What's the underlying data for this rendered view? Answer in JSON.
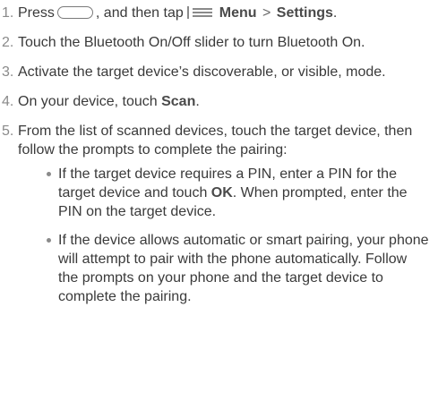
{
  "steps": [
    {
      "number": "1.",
      "parts": {
        "press": "Press",
        "then_tap": ", and then tap",
        "menu": "Menu",
        "separator": ">",
        "settings": "Settings",
        "period": "."
      },
      "icons": [
        "home-key-icon",
        "menu-key-icon"
      ]
    },
    {
      "number": "2.",
      "text": "Touch the Bluetooth On/Off slider to turn Bluetooth On."
    },
    {
      "number": "3.",
      "text": "Activate the target device’s discoverable, or visible, mode."
    },
    {
      "number": "4.",
      "parts": {
        "lead": "On your device, touch ",
        "scan": "Scan",
        "period": "."
      }
    },
    {
      "number": "5.",
      "text": "From the list of scanned devices, touch the target device, then follow the prompts to complete the pairing:",
      "bullets": [
        {
          "lead": "If the target device requires a PIN, enter a PIN for the target device and touch ",
          "ok": "OK",
          "tail": ". When prompted, enter the PIN on the target device."
        },
        {
          "text": "If the device allows automatic or smart pairing, your phone will attempt to pair with the phone automatically. Follow the prompts on your phone and the target device to complete the pairing."
        }
      ]
    }
  ]
}
